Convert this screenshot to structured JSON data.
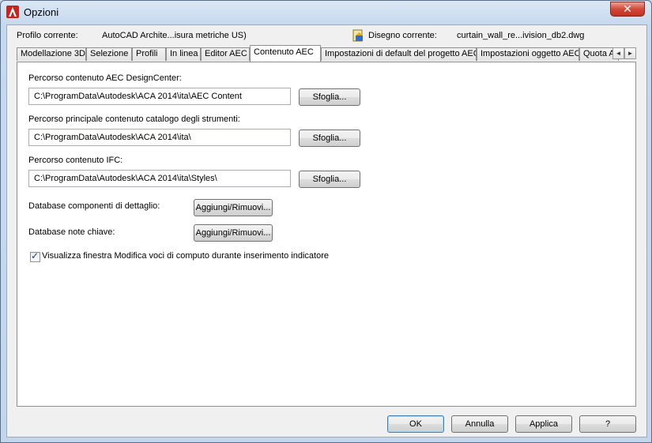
{
  "window": {
    "title": "Opzioni",
    "close_label": "✕"
  },
  "profile": {
    "label": "Profilo corrente:",
    "value": "AutoCAD Archite...isura metriche US)"
  },
  "drawing": {
    "label": "Disegno corrente:",
    "value": "curtain_wall_re...ivision_db2.dwg"
  },
  "tabs": [
    "Modellazione 3D",
    "Selezione",
    "Profili",
    "In linea",
    "Editor AEC",
    "Contenuto AEC",
    "Impostazioni di default del progetto AEC",
    "Impostazioni oggetto AEC",
    "Quota AEC"
  ],
  "tab_scroll": {
    "left": "◄",
    "right": "►"
  },
  "content": {
    "designcenter": {
      "label": "Percorso contenuto AEC DesignCenter:",
      "value": "C:\\ProgramData\\Autodesk\\ACA 2014\\ita\\AEC Content",
      "button": "Sfoglia..."
    },
    "catalog": {
      "label": "Percorso principale contenuto catalogo degli strumenti:",
      "value": "C:\\ProgramData\\Autodesk\\ACA 2014\\ita\\",
      "button": "Sfoglia..."
    },
    "ifc": {
      "label": "Percorso contenuto IFC:",
      "value": "C:\\ProgramData\\Autodesk\\ACA 2014\\ita\\Styles\\",
      "button": "Sfoglia..."
    },
    "detail_db": {
      "label": "Database componenti di dettaglio:",
      "button": "Aggiungi/Rimuovi..."
    },
    "keynote_db": {
      "label": "Database note chiave:",
      "button": "Aggiungi/Rimuovi..."
    },
    "checkbox": {
      "label": "Visualizza finestra Modifica voci di computo durante inserimento indicatore",
      "checked": true
    }
  },
  "footer": {
    "ok": "OK",
    "cancel": "Annulla",
    "apply": "Applica",
    "help": "?"
  }
}
